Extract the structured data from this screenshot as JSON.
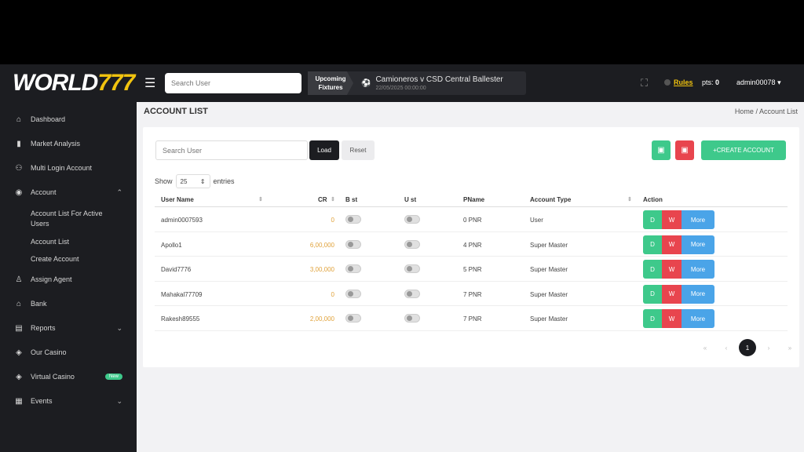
{
  "brand": {
    "logo_left": "WORLD",
    "logo_right": "777"
  },
  "topbar": {
    "search_placeholder": "Search User",
    "fixtures_label_1": "Upcoming",
    "fixtures_label_2": "Fixtures",
    "fixture_match": "Camioneros v CSD Central Ballester",
    "fixture_date": "22/05/2025 00:00:00",
    "rules": "Rules",
    "pts_label": "pts:",
    "pts_value": "0",
    "user": "admin00078"
  },
  "sidebar": {
    "dashboard": "Dashboard",
    "market_analysis": "Market Analysis",
    "multi_login": "Multi Login Account",
    "account": "Account",
    "account_list_active": "Account List For Active Users",
    "account_list": "Account List",
    "create_account": "Create Account",
    "assign_agent": "Assign Agent",
    "bank": "Bank",
    "reports": "Reports",
    "our_casino": "Our Casino",
    "virtual_casino": "Virtual Casino",
    "new_badge": "New",
    "events": "Events"
  },
  "main": {
    "title": "ACCOUNT LIST",
    "breadcrumb_home": "Home",
    "breadcrumb_sep": "/",
    "breadcrumb_current": "Account List",
    "search_placeholder": "Search User",
    "load": "Load",
    "reset": "Reset",
    "create_account": "CREATE ACCOUNT",
    "show": "Show",
    "entries_value": "25",
    "entries": "entries"
  },
  "table": {
    "headers": {
      "user": "User Name",
      "cr": "CR",
      "bst": "B st",
      "ust": "U st",
      "pname": "PName",
      "type": "Account Type",
      "action": "Action"
    },
    "rows": [
      {
        "user": "admin0007593",
        "cr": "0",
        "pname": "0 PNR",
        "type": "User"
      },
      {
        "user": "Apollo1",
        "cr": "6,00,000",
        "pname": "4 PNR",
        "type": "Super Master"
      },
      {
        "user": "David7776",
        "cr": "3,00,000",
        "pname": "5 PNR",
        "type": "Super Master"
      },
      {
        "user": "Mahakal77709",
        "cr": "0",
        "pname": "7 PNR",
        "type": "Super Master"
      },
      {
        "user": "Rakesh89555",
        "cr": "2,00,000",
        "pname": "7 PNR",
        "type": "Super Master"
      }
    ],
    "action_d": "D",
    "action_w": "W",
    "action_more": "More"
  },
  "pagination": {
    "first": "«",
    "prev": "‹",
    "current": "1",
    "next": "›",
    "last": "»"
  }
}
